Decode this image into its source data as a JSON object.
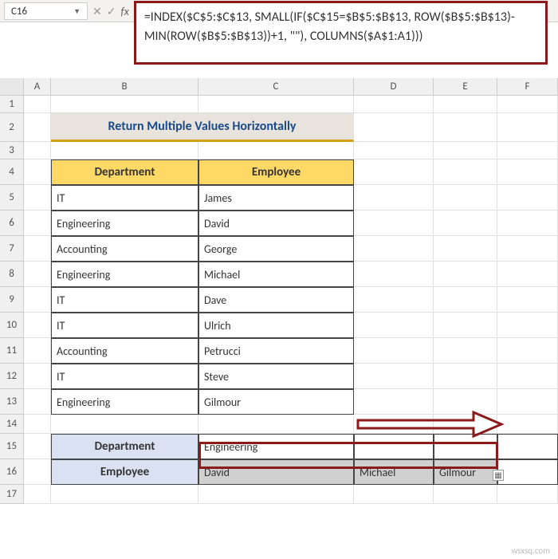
{
  "nameBox": "C16",
  "formula": "=INDEX($C$5:$C$13, SMALL(IF($C$15=$B$5:$B$13, ROW($B$5:$B$13)-MIN(ROW($B$5:$B$13))+1, \"\"), COLUMNS($A$1:A1)))",
  "columns": [
    "A",
    "B",
    "C",
    "D",
    "E",
    "F"
  ],
  "rows": [
    "1",
    "2",
    "3",
    "4",
    "5",
    "6",
    "7",
    "8",
    "9",
    "10",
    "11",
    "12",
    "13",
    "14",
    "15",
    "16",
    "17"
  ],
  "title": "Return Multiple Values Horizontally",
  "headers": {
    "dept": "Department",
    "emp": "Employee"
  },
  "table": [
    {
      "dept": "IT",
      "emp": "James"
    },
    {
      "dept": "Engineering",
      "emp": "David"
    },
    {
      "dept": "Accounting",
      "emp": "George"
    },
    {
      "dept": "Engineering",
      "emp": "Michael"
    },
    {
      "dept": "IT",
      "emp": "Dave"
    },
    {
      "dept": "IT",
      "emp": "Ulrich"
    },
    {
      "dept": "Accounting",
      "emp": "Petrucci"
    },
    {
      "dept": "IT",
      "emp": "Steve"
    },
    {
      "dept": "Engineering",
      "emp": "Gilmour"
    }
  ],
  "lookup": {
    "deptLabel": "Department",
    "empLabel": "Employee",
    "deptValue": "Engineering",
    "results": [
      "David",
      "Michael",
      "Gilmour"
    ]
  },
  "watermark": "wsxsq.com"
}
